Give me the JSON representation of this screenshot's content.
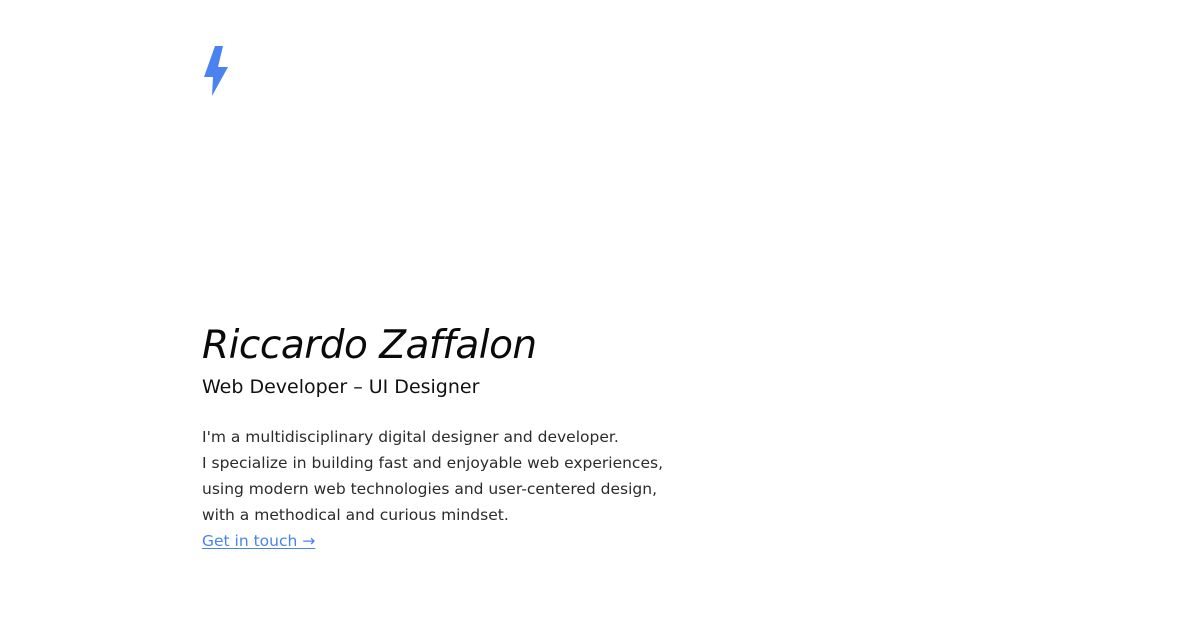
{
  "brand": {
    "logo_icon": "lightning-bolt-icon",
    "accent_color": "#4a82f0"
  },
  "hero": {
    "name": "Riccardo Zaffalon",
    "role": "Web Developer – UI Designer",
    "bio_lines": [
      "I'm a multidisciplinary digital designer and developer.",
      "I specialize in building fast and enjoyable web experiences,",
      "using modern web technologies and user-centered design,",
      "with a methodical and curious mindset."
    ],
    "cta_label": "Get in touch →"
  }
}
